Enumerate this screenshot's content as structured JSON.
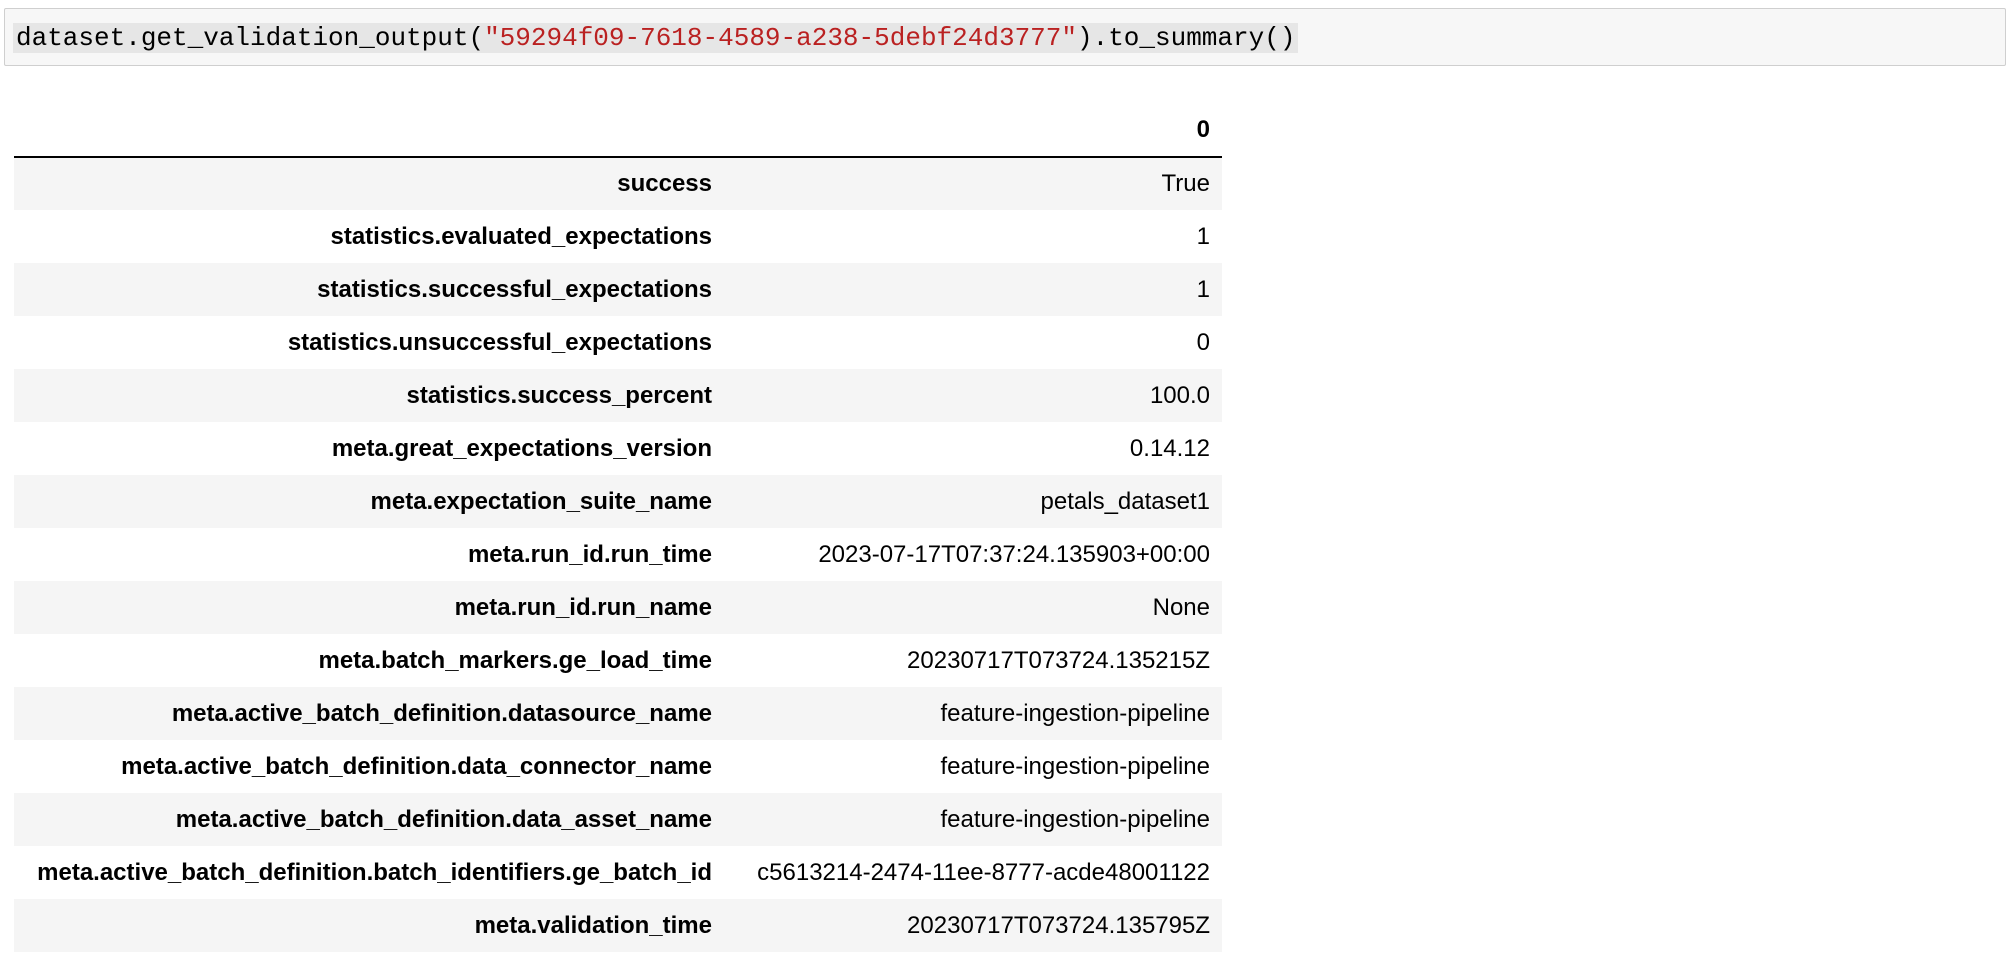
{
  "code_cell": {
    "prefix": "dataset.get_validation_output(",
    "string_literal": "\"59294f09-7618-4589-a238-5debf24d3777\"",
    "suffix": ").to_summary()"
  },
  "table": {
    "column_header": "0",
    "rows": [
      {
        "key": "success",
        "value": "True"
      },
      {
        "key": "statistics.evaluated_expectations",
        "value": "1"
      },
      {
        "key": "statistics.successful_expectations",
        "value": "1"
      },
      {
        "key": "statistics.unsuccessful_expectations",
        "value": "0"
      },
      {
        "key": "statistics.success_percent",
        "value": "100.0"
      },
      {
        "key": "meta.great_expectations_version",
        "value": "0.14.12"
      },
      {
        "key": "meta.expectation_suite_name",
        "value": "petals_dataset1"
      },
      {
        "key": "meta.run_id.run_time",
        "value": "2023-07-17T07:37:24.135903+00:00"
      },
      {
        "key": "meta.run_id.run_name",
        "value": "None"
      },
      {
        "key": "meta.batch_markers.ge_load_time",
        "value": "20230717T073724.135215Z"
      },
      {
        "key": "meta.active_batch_definition.datasource_name",
        "value": "feature-ingestion-pipeline"
      },
      {
        "key": "meta.active_batch_definition.data_connector_name",
        "value": "feature-ingestion-pipeline"
      },
      {
        "key": "meta.active_batch_definition.data_asset_name",
        "value": "feature-ingestion-pipeline"
      },
      {
        "key": "meta.active_batch_definition.batch_identifiers.ge_batch_id",
        "value": "c5613214-2474-11ee-8777-acde48001122"
      },
      {
        "key": "meta.validation_time",
        "value": "20230717T073724.135795Z"
      }
    ]
  }
}
